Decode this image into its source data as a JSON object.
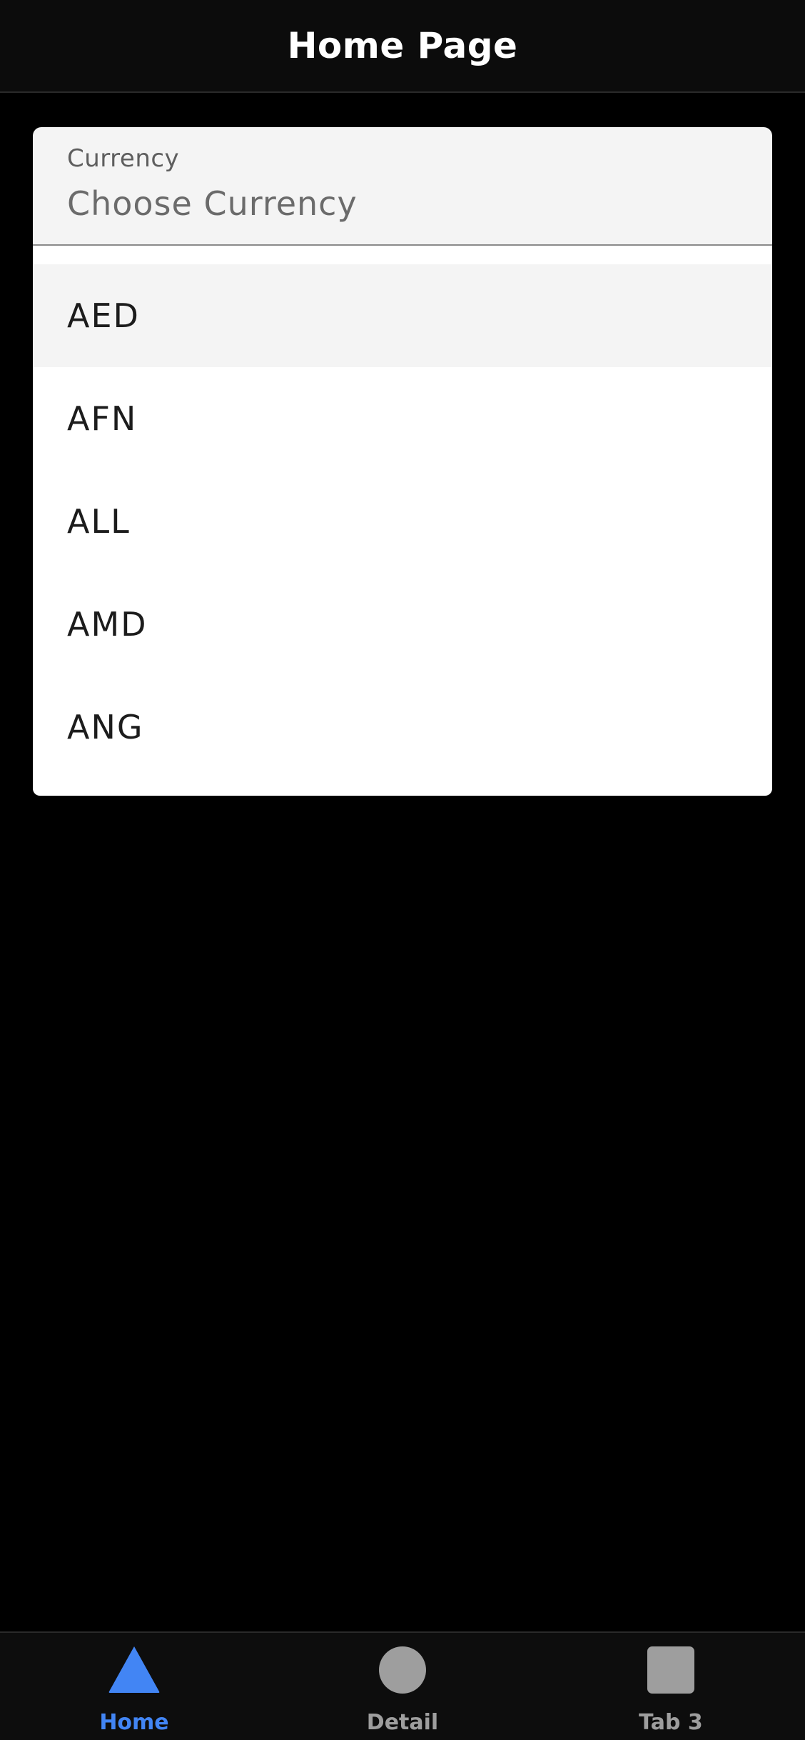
{
  "app_bar": {
    "title": "Home Page"
  },
  "currency_field": {
    "label": "Currency",
    "placeholder": "Choose Currency"
  },
  "dropdown": {
    "options": [
      "AED",
      "AFN",
      "ALL",
      "AMD",
      "ANG"
    ],
    "highlighted": "AED"
  },
  "bottom_nav": {
    "active_color": "#4285f4",
    "inactive_color": "#9e9e9e",
    "items": [
      {
        "label": "Home",
        "icon": "triangle-icon",
        "active": true
      },
      {
        "label": "Detail",
        "icon": "circle-icon",
        "active": false
      },
      {
        "label": "Tab 3",
        "icon": "square-icon",
        "active": false
      }
    ]
  }
}
